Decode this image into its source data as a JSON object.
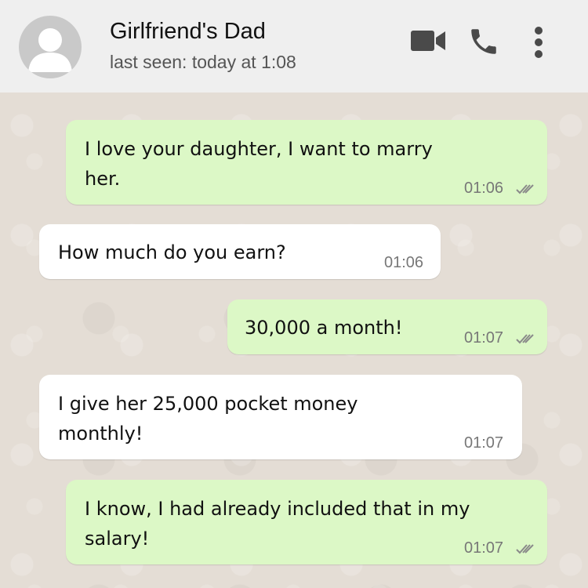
{
  "header": {
    "contact_name": "Girlfriend's Dad",
    "status": "last seen: today at 1:08",
    "icons": [
      "avatar-icon",
      "video-call-icon",
      "phone-icon",
      "more-options-icon"
    ]
  },
  "messages": [
    {
      "direction": "outgoing",
      "text": "I love your daughter, I want to marry her.",
      "line1": "I love your daughter, I want to marry",
      "line2": "her.",
      "time": "01:06",
      "read": true
    },
    {
      "direction": "incoming",
      "text": "How much do you earn?",
      "line1": "How much do you earn?",
      "time": "01:06"
    },
    {
      "direction": "outgoing",
      "text": "30,000 a month!",
      "line1": "30,000 a month!",
      "time": "01:07",
      "read": true
    },
    {
      "direction": "incoming",
      "text": "I give her 25,000 pocket money monthly!",
      "line1": "I give her 25,000 pocket money",
      "line2": "monthly!",
      "time": "01:07"
    },
    {
      "direction": "outgoing",
      "text": "I know, I had already included that in my salary!",
      "line1": "I know, I had already included that in my",
      "line2": "salary!",
      "time": "01:07",
      "read": true
    }
  ],
  "colors": {
    "header_bg": "#efefef",
    "chat_bg": "#e4ddd5",
    "outgoing_bubble": "#dcf8c6",
    "incoming_bubble": "#ffffff",
    "icon": "#4a4a4a",
    "ticks": "#8a8a8a"
  }
}
